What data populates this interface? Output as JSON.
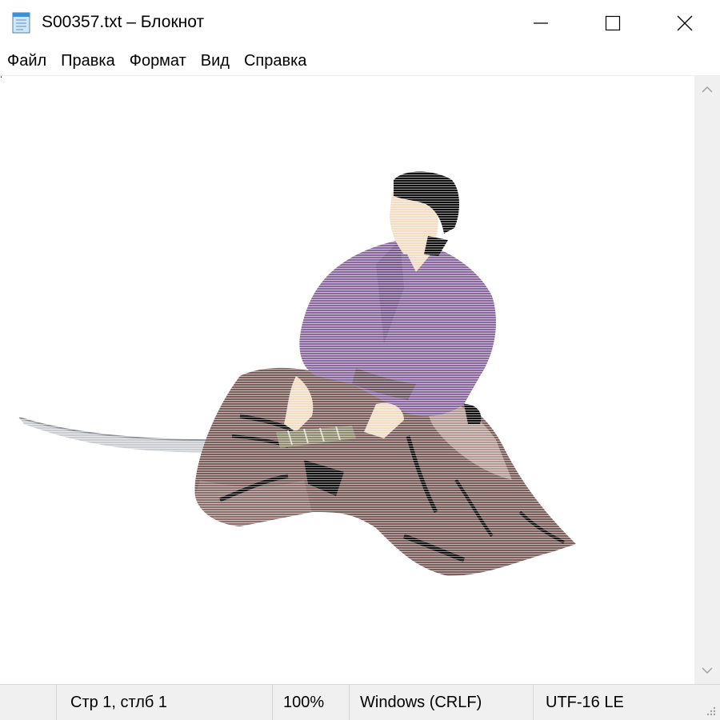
{
  "window": {
    "title": "S00357.txt – Блокнот",
    "icon": "notepad-icon",
    "controls": [
      "minimize-icon",
      "maximize-icon",
      "close-icon"
    ]
  },
  "menu": {
    "items": [
      "Файл",
      "Правка",
      "Формат",
      "Вид",
      "Справка"
    ]
  },
  "editor": {
    "content": "ASCII-art image rendered as text lines: seated samurai with katana",
    "colors": {
      "robe": "#8a6a9e",
      "hakama": "#7a5e5c",
      "hakama_light": "#b39a95",
      "skin": "#f1dcc4",
      "hair": "#111111",
      "blade": "#c9ccd0"
    }
  },
  "statusbar": {
    "position": "Стр 1, стлб 1",
    "zoom": "100%",
    "line_endings": "Windows (CRLF)",
    "encoding": "UTF-16 LE"
  }
}
